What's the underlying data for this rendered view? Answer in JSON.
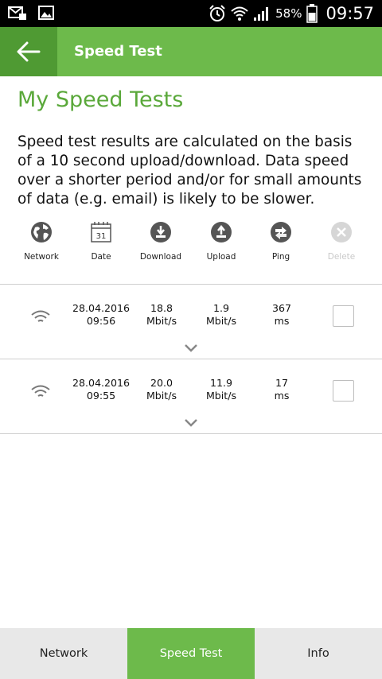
{
  "status_bar": {
    "battery_percent": "58%",
    "time": "09:57",
    "icons": [
      "mail-icon",
      "image-icon",
      "alarm-icon",
      "wifi-icon",
      "signal-icon",
      "battery-icon"
    ]
  },
  "app_bar": {
    "title": "Speed Test",
    "back_icon": "arrow-left-icon"
  },
  "heading": "My Speed Tests",
  "intro": "Speed test results are calculated on the basis of a 10 second upload/download. Data speed over a shorter period and/or for small amounts of data (e.g. email) is likely to be slower.",
  "toolbar": {
    "network": "Network",
    "date": "Date",
    "date_icon_day": "31",
    "download": "Download",
    "upload": "Upload",
    "ping": "Ping",
    "delete": "Delete"
  },
  "results": [
    {
      "date": "28.04.2016",
      "time": "09:56",
      "download_value": "18.8",
      "download_unit": "Mbit/s",
      "upload_value": "1.9",
      "upload_unit": "Mbit/s",
      "ping_value": "367",
      "ping_unit": "ms"
    },
    {
      "date": "28.04.2016",
      "time": "09:55",
      "download_value": "20.0",
      "download_unit": "Mbit/s",
      "upload_value": "11.9",
      "upload_unit": "Mbit/s",
      "ping_value": "17",
      "ping_unit": "ms"
    }
  ],
  "bottom_nav": {
    "network": "Network",
    "speed_test": "Speed Test",
    "info": "Info",
    "active": "Speed Test"
  },
  "colors": {
    "brand_green": "#6dba4b",
    "brand_green_dark": "#4f9a33",
    "heading_green": "#5aa83a"
  }
}
